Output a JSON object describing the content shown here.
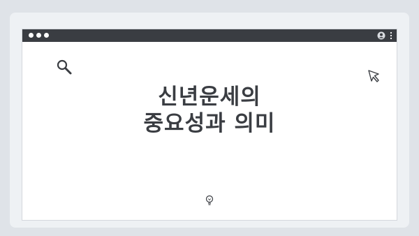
{
  "window": {
    "icons": [
      "user-icon",
      "kebab-menu-icon"
    ]
  },
  "content": {
    "headline_line1": "신년운세의",
    "headline_line2": "중요성과 의미",
    "icons": [
      "search-icon",
      "cursor-arrow-icon",
      "lightbulb-icon"
    ]
  },
  "colors": {
    "background": "#dfe3e8",
    "titlebar": "#3a3d42",
    "text": "#3a3d42",
    "window": "#ffffff"
  }
}
